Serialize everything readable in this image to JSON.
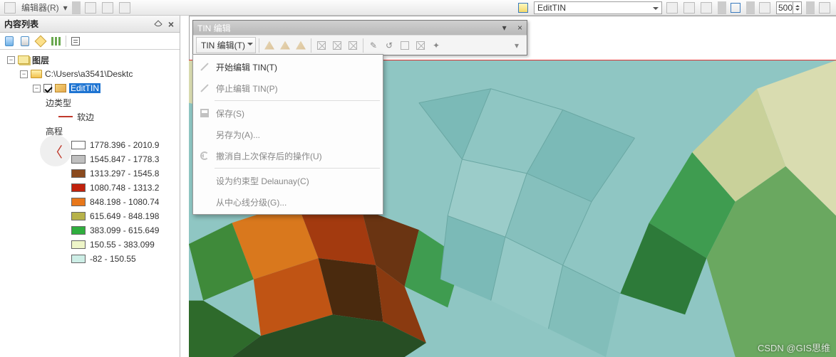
{
  "topbar": {
    "editor_label": "编辑器(R)",
    "layer_box": "EditTIN",
    "number_box": "500"
  },
  "toc": {
    "title": "内容列表",
    "root_label": "图层",
    "folder_label": "C:\\Users\\a3541\\Desktc",
    "layer_name": "EditTIN",
    "edge_type_label": "边类型",
    "soft_edge_label": "软边",
    "elevation_label": "高程",
    "classes": [
      {
        "label": "1778.396 - 2010.9",
        "color": "#ffffff"
      },
      {
        "label": "1545.847 - 1778.3",
        "color": "#bfbfbf"
      },
      {
        "label": "1313.297 - 1545.8",
        "color": "#8a4a1e"
      },
      {
        "label": "1080.748 - 1313.2",
        "color": "#c1210c"
      },
      {
        "label": "848.198 - 1080.74",
        "color": "#e8771a"
      },
      {
        "label": "615.649 - 848.198",
        "color": "#b7b24a"
      },
      {
        "label": "383.099 - 615.649",
        "color": "#2fae3e"
      },
      {
        "label": "150.55 - 383.099",
        "color": "#eef5c8"
      },
      {
        "label": "-82 - 150.55",
        "color": "#cdeee6"
      }
    ]
  },
  "tin_toolbar": {
    "title": "TIN 编辑",
    "menu_label": "TIN 编辑(T)"
  },
  "dropdown": {
    "items": [
      {
        "label": "开始编辑 TIN(T)",
        "enabled": true,
        "icon": "pencil"
      },
      {
        "label": "停止编辑 TIN(P)",
        "enabled": false,
        "icon": "pencil"
      },
      {
        "sep": true
      },
      {
        "label": "保存(S)",
        "enabled": false,
        "icon": "floppy"
      },
      {
        "label": "另存为(A)...",
        "enabled": false,
        "icon": ""
      },
      {
        "label": "撤消自上次保存后的操作(U)",
        "enabled": false,
        "icon": "undo"
      },
      {
        "sep": true
      },
      {
        "label": "设为约束型 Delaunay(C)",
        "enabled": false,
        "icon": ""
      },
      {
        "label": "从中心线分级(G)...",
        "enabled": false,
        "icon": ""
      }
    ]
  },
  "watermark": "CSDN @GIS思维"
}
